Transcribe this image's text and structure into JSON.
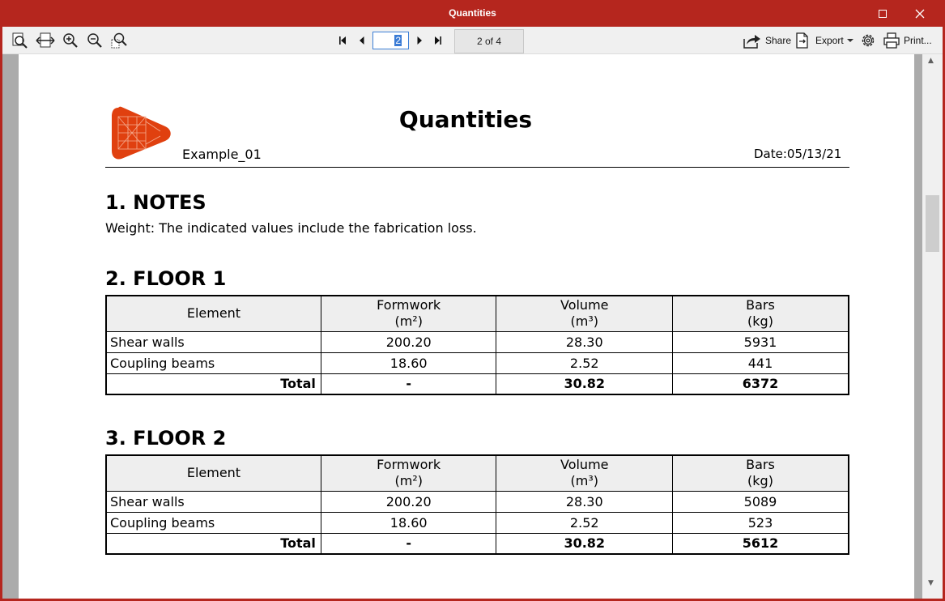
{
  "window": {
    "title": "Quantities"
  },
  "toolbar": {
    "current_page": "2",
    "page_count": "2 of 4",
    "share_label": "Share",
    "export_label": "Export",
    "print_label": "Print..."
  },
  "document": {
    "title": "Quantities",
    "project": "Example_01",
    "date_label": "Date:",
    "date_value": "05/13/21",
    "sections": [
      {
        "heading": "1. NOTES",
        "text": "Weight: The indicated values include the fabrication loss."
      },
      {
        "heading": "2. FLOOR 1",
        "columns": [
          {
            "name": "Element",
            "unit": ""
          },
          {
            "name": "Formwork",
            "unit": "(m²)"
          },
          {
            "name": "Volume",
            "unit": "(m³)"
          },
          {
            "name": "Bars",
            "unit": "(kg)"
          }
        ],
        "rows": [
          {
            "element": "Shear walls",
            "formwork": "200.20",
            "volume": "28.30",
            "bars": "5931"
          },
          {
            "element": "Coupling beams",
            "formwork": "18.60",
            "volume": "2.52",
            "bars": "441"
          }
        ],
        "total": {
          "element": "Total",
          "formwork": "-",
          "volume": "30.82",
          "bars": "6372"
        }
      },
      {
        "heading": "3. FLOOR 2",
        "columns": [
          {
            "name": "Element",
            "unit": ""
          },
          {
            "name": "Formwork",
            "unit": "(m²)"
          },
          {
            "name": "Volume",
            "unit": "(m³)"
          },
          {
            "name": "Bars",
            "unit": "(kg)"
          }
        ],
        "rows": [
          {
            "element": "Shear walls",
            "formwork": "200.20",
            "volume": "28.30",
            "bars": "5089"
          },
          {
            "element": "Coupling beams",
            "formwork": "18.60",
            "volume": "2.52",
            "bars": "523"
          }
        ],
        "total": {
          "element": "Total",
          "formwork": "-",
          "volume": "30.82",
          "bars": "5612"
        }
      }
    ]
  },
  "colors": {
    "titlebar": "#b5261e",
    "logo": "#e0400f",
    "header_fill": "#eeeeee"
  },
  "icons": [
    "zoom-page-icon",
    "fit-width-icon",
    "zoom-in-icon",
    "zoom-out-icon",
    "zoom-window-icon",
    "first-page-icon",
    "prev-page-icon",
    "next-page-icon",
    "last-page-icon",
    "share-icon",
    "export-icon",
    "settings-gear-icon",
    "printer-icon"
  ]
}
